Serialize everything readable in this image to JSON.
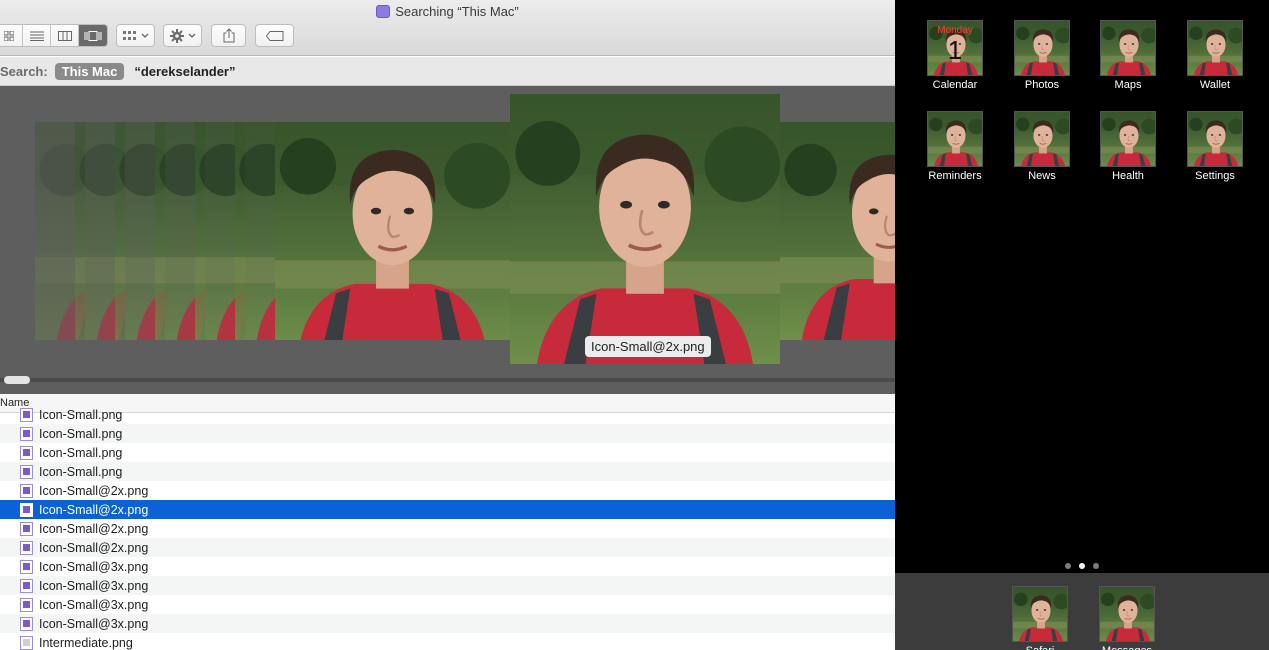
{
  "window": {
    "title": "Searching “This Mac”"
  },
  "toolbar": {
    "view_buttons": [
      "icon-view",
      "list-view",
      "column-view",
      "cover-flow-view"
    ],
    "arrange_icon": "grid-arrange-icon",
    "action_icon": "gear-icon",
    "share_icon": "share-icon",
    "tag_icon": "tag-icon"
  },
  "search": {
    "label": "Search:",
    "scope": "This Mac",
    "query": "“derekselander”"
  },
  "coverflow": {
    "caption": "Icon-Small@2x.png"
  },
  "list": {
    "column_header": "Name",
    "files": [
      {
        "name": "Icon-Small.png",
        "selected": false
      },
      {
        "name": "Icon-Small.png",
        "selected": false
      },
      {
        "name": "Icon-Small.png",
        "selected": false
      },
      {
        "name": "Icon-Small.png",
        "selected": false
      },
      {
        "name": "Icon-Small@2x.png",
        "selected": false
      },
      {
        "name": "Icon-Small@2x.png",
        "selected": true
      },
      {
        "name": "Icon-Small@2x.png",
        "selected": false
      },
      {
        "name": "Icon-Small@2x.png",
        "selected": false
      },
      {
        "name": "Icon-Small@3x.png",
        "selected": false
      },
      {
        "name": "Icon-Small@3x.png",
        "selected": false
      },
      {
        "name": "Icon-Small@3x.png",
        "selected": false
      },
      {
        "name": "Icon-Small@3x.png",
        "selected": false
      },
      {
        "name": "Intermediate.png",
        "selected": false
      }
    ]
  },
  "simulator": {
    "calendar": {
      "day": "Monday",
      "date": "1"
    },
    "apps_row1": [
      "Calendar",
      "Photos",
      "Maps",
      "Wallet"
    ],
    "apps_row2": [
      "Reminders",
      "News",
      "Health",
      "Settings"
    ],
    "page_dots": {
      "count": 3,
      "current": 1
    },
    "dock": [
      "Safari",
      "Messages"
    ]
  }
}
